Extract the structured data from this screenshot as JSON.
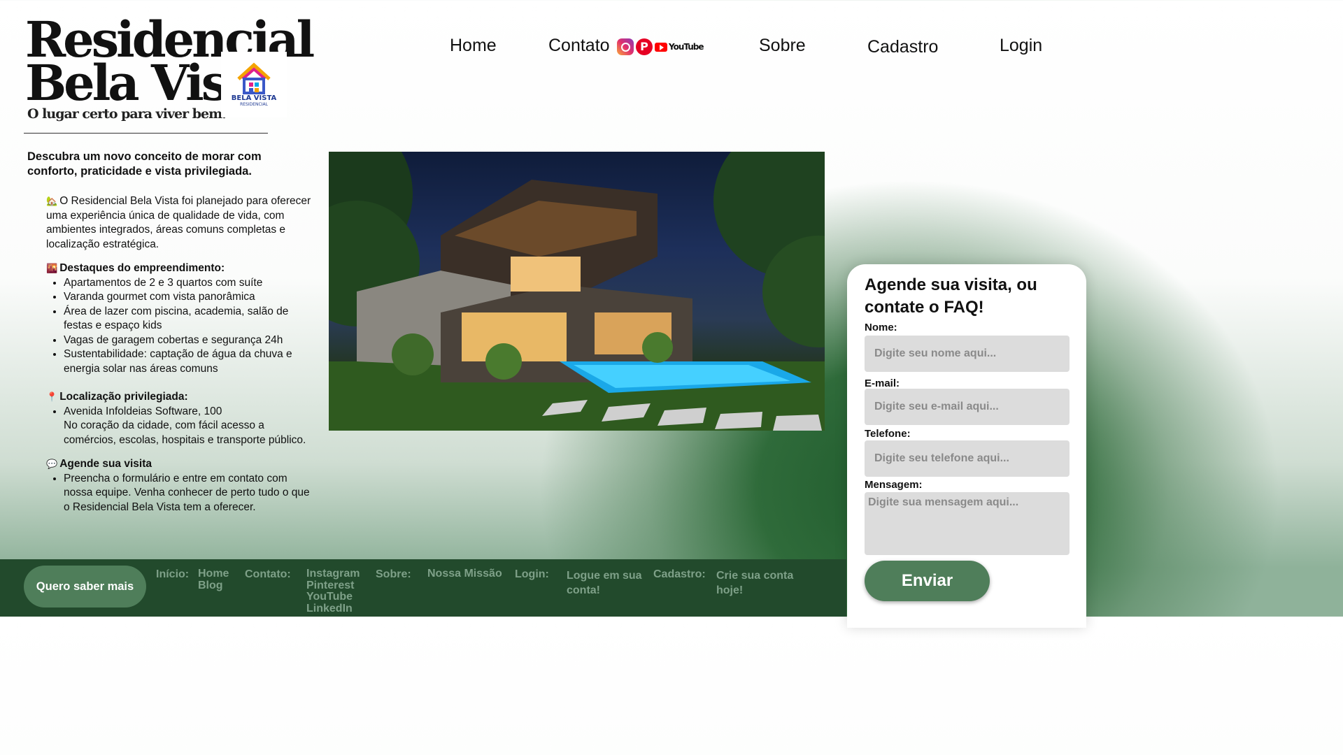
{
  "logo": {
    "line1": "Residencial",
    "line2": "Bela Vista",
    "tagline": "O lugar certo para viver bem.",
    "badge_line1": "BELA VISTA",
    "badge_line2": "RESIDENCIAL",
    "badge_icon": "house-logo-icon"
  },
  "nav": {
    "home": "Home",
    "contato": "Contato",
    "sobre": "Sobre",
    "cadastro": "Cadastro",
    "login": "Login",
    "youtube_text": "YouTube"
  },
  "intro": "Descubra um novo conceito de morar com conforto, praticidade e vista privilegiada.",
  "sections": {
    "about_text": "O Residencial Bela Vista foi planejado para oferecer uma experiência única de qualidade de vida, com ambientes integrados, áreas comuns completas e localização estratégica.",
    "highlights_title": "Destaques do empreendimento:",
    "highlights": [
      "Apartamentos de 2 e 3 quartos com suíte",
      "Varanda gourmet com vista panorâmica",
      "Área de lazer com piscina, academia, salão de festas e espaço kids",
      "Vagas de garagem cobertas e segurança 24h",
      "Sustentabilidade: captação de água da chuva e energia solar nas áreas comuns"
    ],
    "location_title": "Localização privilegiada:",
    "location_address": "Avenida Infoldeias Software, 100",
    "location_desc": "No coração da cidade, com fácil acesso a comércios, escolas, hospitais e transporte público.",
    "visit_title": "Agende sua visita",
    "visit_text": "Preencha o formulário e entre em contato com nossa equipe. Venha conhecer de perto tudo o que o Residencial Bela Vista tem a oferecer."
  },
  "form": {
    "title": "Agende sua visita, ou contate o FAQ!",
    "name_label": "Nome:",
    "name_placeholder": "Digite seu nome aqui...",
    "email_label": "E-mail:",
    "email_placeholder": "Digite seu e-mail aqui...",
    "phone_label": "Telefone:",
    "phone_placeholder": "Digite seu telefone aqui...",
    "message_label": "Mensagem:",
    "message_placeholder": "Digite sua mensagem aqui...",
    "submit": "Enviar"
  },
  "footer": {
    "cta": "Quero saber mais",
    "inicio_label": "Início:",
    "inicio_links": [
      "Home",
      "Blog"
    ],
    "contato_label": "Contato:",
    "contato_links": [
      "Instagram",
      "Pinterest",
      "YouTube",
      "LinkedIn"
    ],
    "sobre_label": "Sobre:",
    "sobre_link": "Nossa Missão",
    "login_label": "Login:",
    "login_link": "Logue em sua conta!",
    "cadastro_label": "Cadastro:",
    "cadastro_link": "Crie sua conta hoje!"
  },
  "colors": {
    "brand_green": "#224a2c",
    "button_green": "#4f7e5a",
    "footer_text": "#7ea088"
  }
}
